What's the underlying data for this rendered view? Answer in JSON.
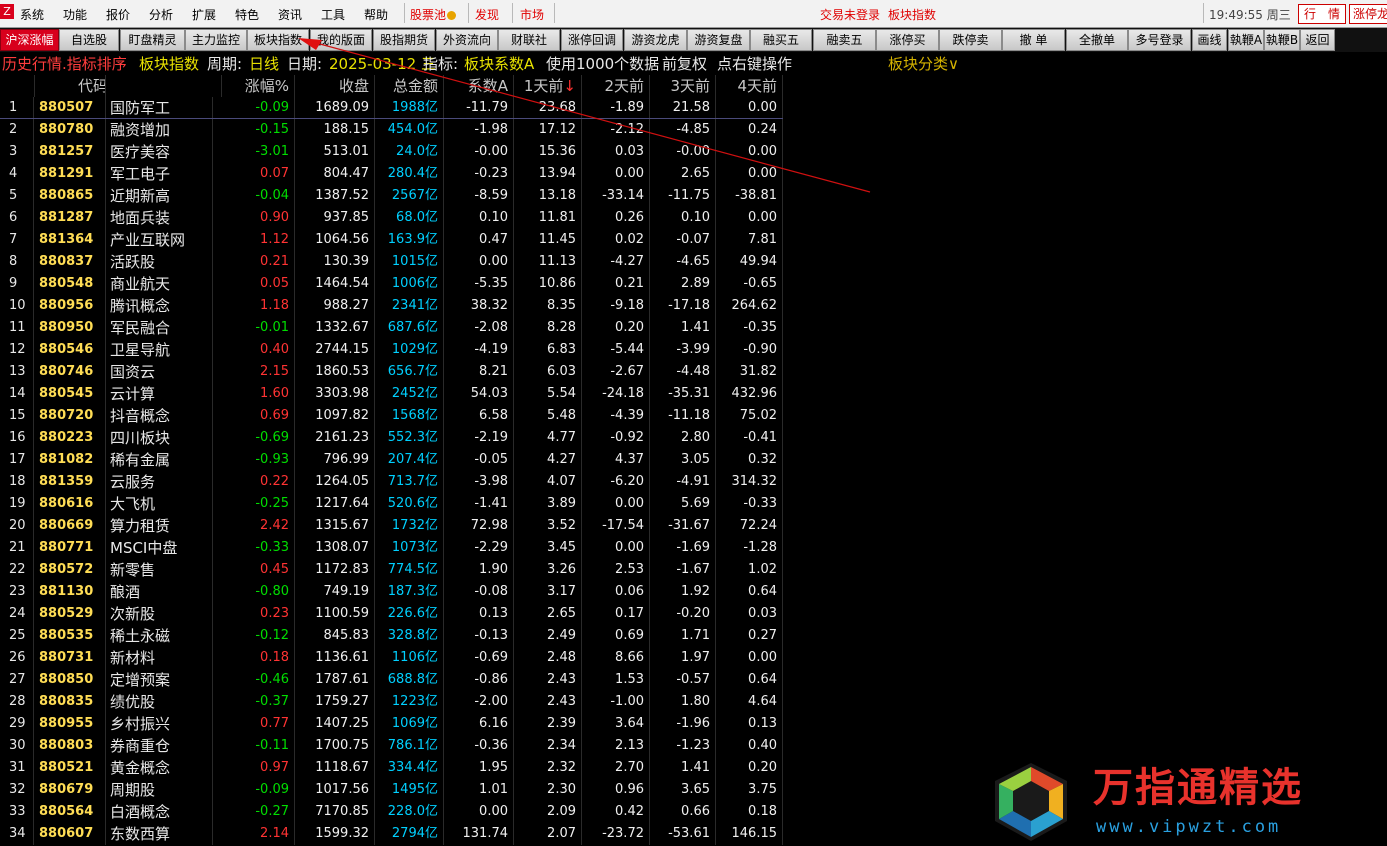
{
  "menubar": {
    "items": [
      "系统",
      "功能",
      "报价",
      "分析",
      "扩展",
      "特色",
      "资讯",
      "工具",
      "帮助"
    ],
    "stock_pool": "股票池",
    "discover": "发现",
    "market": "市场",
    "login_status": "交易未登录",
    "current_page": "板块指数",
    "clock": "19:49:55 周三",
    "btn_quote": "行　情",
    "btn_limit": "涨停龙"
  },
  "toolbar": {
    "buttons": [
      "沪深涨幅",
      "自选股",
      "盯盘精灵",
      "主力监控",
      "板块指数",
      "我的版面",
      "股指期货",
      "外资流向",
      "财联社",
      "涨停回调",
      "游资龙虎",
      "游资复盘",
      "融买五",
      "融卖五",
      "涨停买",
      "跌停卖",
      "撤 单",
      "全撤单",
      "多号登录",
      "画线",
      "執鞭A",
      "執鞭B",
      "返回"
    ]
  },
  "infoline": {
    "mode": "历史行情.指标排序",
    "category": "板块指数",
    "period_label": "周期:",
    "period": "日线",
    "date_label": "日期:",
    "date": "2025-03-12 三",
    "indicator_label": "指标:",
    "indicator": "板块系数A",
    "usage": "使用1000个数据",
    "adjust": "前复权",
    "hint": "点右键操作",
    "classify": "板块分类∨"
  },
  "table": {
    "headers": [
      "",
      "代码",
      "名称",
      "涨幅%",
      "收盘",
      "总金额",
      "系数A",
      "1天前↓",
      "2天前",
      "3天前",
      "4天前"
    ],
    "rows": [
      [
        "1",
        "880507",
        "国防军工",
        "-0.09",
        "1689.09",
        "1988亿",
        "-11.79",
        "23.68",
        "-1.89",
        "21.58",
        "0.00"
      ],
      [
        "2",
        "880780",
        "融资增加",
        "-0.15",
        "188.15",
        "454.0亿",
        "-1.98",
        "17.12",
        "-2.12",
        "-4.85",
        "0.24"
      ],
      [
        "3",
        "881257",
        "医疗美容",
        "-3.01",
        "513.01",
        "24.0亿",
        "-0.00",
        "15.36",
        "0.03",
        "-0.00",
        "0.00"
      ],
      [
        "4",
        "881291",
        "军工电子",
        "0.07",
        "804.47",
        "280.4亿",
        "-0.23",
        "13.94",
        "0.00",
        "2.65",
        "0.00"
      ],
      [
        "5",
        "880865",
        "近期新高",
        "-0.04",
        "1387.52",
        "2567亿",
        "-8.59",
        "13.18",
        "-33.14",
        "-11.75",
        "-38.81"
      ],
      [
        "6",
        "881287",
        "地面兵装",
        "0.90",
        "937.85",
        "68.0亿",
        "0.10",
        "11.81",
        "0.26",
        "0.10",
        "0.00"
      ],
      [
        "7",
        "881364",
        "产业互联网",
        "1.12",
        "1064.56",
        "163.9亿",
        "0.47",
        "11.45",
        "0.02",
        "-0.07",
        "7.81"
      ],
      [
        "8",
        "880837",
        "活跃股",
        "0.21",
        "130.39",
        "1015亿",
        "0.00",
        "11.13",
        "-4.27",
        "-4.65",
        "49.94"
      ],
      [
        "9",
        "880548",
        "商业航天",
        "0.05",
        "1464.54",
        "1006亿",
        "-5.35",
        "10.86",
        "0.21",
        "2.89",
        "-0.65"
      ],
      [
        "10",
        "880956",
        "腾讯概念",
        "1.18",
        "988.27",
        "2341亿",
        "38.32",
        "8.35",
        "-9.18",
        "-17.18",
        "264.62"
      ],
      [
        "11",
        "880950",
        "军民融合",
        "-0.01",
        "1332.67",
        "687.6亿",
        "-2.08",
        "8.28",
        "0.20",
        "1.41",
        "-0.35"
      ],
      [
        "12",
        "880546",
        "卫星导航",
        "0.40",
        "2744.15",
        "1029亿",
        "-4.19",
        "6.83",
        "-5.44",
        "-3.99",
        "-0.90"
      ],
      [
        "13",
        "880746",
        "国资云",
        "2.15",
        "1860.53",
        "656.7亿",
        "8.21",
        "6.03",
        "-2.67",
        "-4.48",
        "31.82"
      ],
      [
        "14",
        "880545",
        "云计算",
        "1.60",
        "3303.98",
        "2452亿",
        "54.03",
        "5.54",
        "-24.18",
        "-35.31",
        "432.96"
      ],
      [
        "15",
        "880720",
        "抖音概念",
        "0.69",
        "1097.82",
        "1568亿",
        "6.58",
        "5.48",
        "-4.39",
        "-11.18",
        "75.02"
      ],
      [
        "16",
        "880223",
        "四川板块",
        "-0.69",
        "2161.23",
        "552.3亿",
        "-2.19",
        "4.77",
        "-0.92",
        "2.80",
        "-0.41"
      ],
      [
        "17",
        "881082",
        "稀有金属",
        "-0.93",
        "796.99",
        "207.4亿",
        "-0.05",
        "4.27",
        "4.37",
        "3.05",
        "0.32"
      ],
      [
        "18",
        "881359",
        "云服务",
        "0.22",
        "1264.05",
        "713.7亿",
        "-3.98",
        "4.07",
        "-6.20",
        "-4.91",
        "314.32"
      ],
      [
        "19",
        "880616",
        "大飞机",
        "-0.25",
        "1217.64",
        "520.6亿",
        "-1.41",
        "3.89",
        "0.00",
        "5.69",
        "-0.33"
      ],
      [
        "20",
        "880669",
        "算力租赁",
        "2.42",
        "1315.67",
        "1732亿",
        "72.98",
        "3.52",
        "-17.54",
        "-31.67",
        "72.24"
      ],
      [
        "21",
        "880771",
        "MSCI中盘",
        "-0.33",
        "1308.07",
        "1073亿",
        "-2.29",
        "3.45",
        "0.00",
        "-1.69",
        "-1.28"
      ],
      [
        "22",
        "880572",
        "新零售",
        "0.45",
        "1172.83",
        "774.5亿",
        "1.90",
        "3.26",
        "2.53",
        "-1.67",
        "1.02"
      ],
      [
        "23",
        "881130",
        "酿酒",
        "-0.80",
        "749.19",
        "187.3亿",
        "-0.08",
        "3.17",
        "0.06",
        "1.92",
        "0.64"
      ],
      [
        "24",
        "880529",
        "次新股",
        "0.23",
        "1100.59",
        "226.6亿",
        "0.13",
        "2.65",
        "0.17",
        "-0.20",
        "0.03"
      ],
      [
        "25",
        "880535",
        "稀土永磁",
        "-0.12",
        "845.83",
        "328.8亿",
        "-0.13",
        "2.49",
        "0.69",
        "1.71",
        "0.27"
      ],
      [
        "26",
        "880731",
        "新材料",
        "0.18",
        "1136.61",
        "1106亿",
        "-0.69",
        "2.48",
        "8.66",
        "1.97",
        "0.00"
      ],
      [
        "27",
        "880850",
        "定增预案",
        "-0.46",
        "1787.61",
        "688.8亿",
        "-0.86",
        "2.43",
        "1.53",
        "-0.57",
        "0.64"
      ],
      [
        "28",
        "880835",
        "绩优股",
        "-0.37",
        "1759.27",
        "1223亿",
        "-2.00",
        "2.43",
        "-1.00",
        "1.80",
        "4.64"
      ],
      [
        "29",
        "880955",
        "乡村振兴",
        "0.77",
        "1407.25",
        "1069亿",
        "6.16",
        "2.39",
        "3.64",
        "-1.96",
        "0.13"
      ],
      [
        "30",
        "880803",
        "券商重仓",
        "-0.11",
        "1700.75",
        "786.1亿",
        "-0.36",
        "2.34",
        "2.13",
        "-1.23",
        "0.40"
      ],
      [
        "31",
        "880521",
        "黄金概念",
        "0.97",
        "1118.67",
        "334.4亿",
        "1.95",
        "2.32",
        "2.70",
        "1.41",
        "0.20"
      ],
      [
        "32",
        "880679",
        "周期股",
        "-0.09",
        "1017.56",
        "1495亿",
        "1.01",
        "2.30",
        "0.96",
        "3.65",
        "3.75"
      ],
      [
        "33",
        "880564",
        "白酒概念",
        "-0.27",
        "7170.85",
        "228.0亿",
        "0.00",
        "2.09",
        "0.42",
        "0.66",
        "0.18"
      ],
      [
        "34",
        "880607",
        "东数西算",
        "2.14",
        "1599.32",
        "2794亿",
        "131.74",
        "2.07",
        "-23.72",
        "-53.61",
        "146.15"
      ]
    ]
  },
  "watermark": {
    "title": "万指通精选",
    "url": "www.vipwzt.com"
  },
  "colors": {
    "up": "#ff3333",
    "down": "#00dd00",
    "amount": "#00d0ff",
    "code": "#ffdd55",
    "active_tab": "#d8001c"
  }
}
